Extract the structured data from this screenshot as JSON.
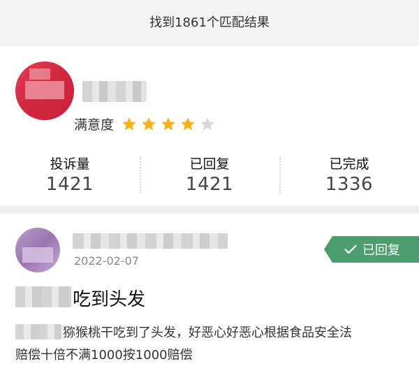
{
  "header": {
    "result_text": "找到1861个匹配结果"
  },
  "merchant": {
    "satisfaction_label": "满意度",
    "rating": 4,
    "rating_max": 5,
    "stats": [
      {
        "label": "投诉量",
        "value": "1421"
      },
      {
        "label": "已回复",
        "value": "1421"
      },
      {
        "label": "已完成",
        "value": "1336"
      }
    ]
  },
  "complaint": {
    "date": "2022-02-07",
    "status": "已回复",
    "title": "吃到头发",
    "body_line1": "猕猴桃干吃到了头发，好恶心好恶心根据食品安全法",
    "body_line2": "赔偿十倍不满1000按1000赔偿"
  },
  "colors": {
    "star_filled": "#f6b31b",
    "star_empty": "#d9d9d9",
    "status_badge": "#4c9e6c"
  }
}
